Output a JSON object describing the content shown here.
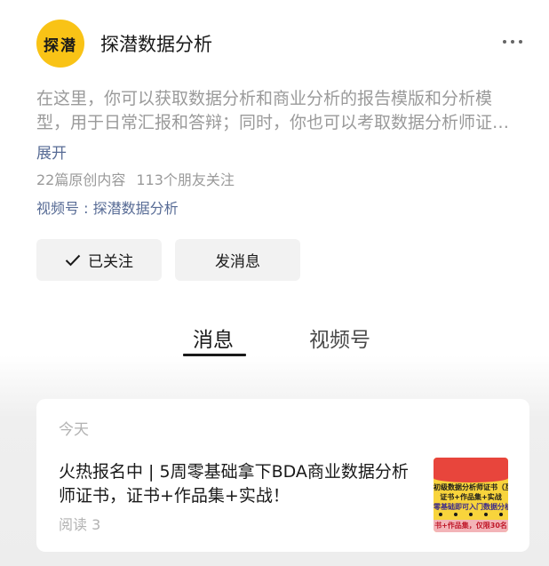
{
  "profile": {
    "avatar_text": "探潜",
    "name": "探潜数据分析",
    "description": "在这里，你可以获取数据分析和商业分析的报告模版和分析模型，用于日常汇报和答辩；同时，你也可以考取数据分析师证书，提升职场竞争力。",
    "expand_label": "展开",
    "original_count": "22篇原创内容",
    "friends_follow": "113个朋友关注",
    "channel": "视频号 : 探潜数据分析"
  },
  "actions": {
    "follow_label": "已关注",
    "message_label": "发消息"
  },
  "tabs": [
    {
      "label": "消息",
      "active": true
    },
    {
      "label": "视频号",
      "active": false
    }
  ],
  "article_card": {
    "date": "今天",
    "title": "火热报名中 | 5周零基础拿下BDA商业数据分析师证书，证书+作品集+实战！",
    "read_count": "阅读 3",
    "thumbnail": {
      "line1": "初级数据分析师证书（互",
      "line2": "证书+作品集+实战",
      "line3": "零基础即可入门数据分析",
      "line4": "书+作品集，仅限30名"
    }
  },
  "colors": {
    "avatar_bg": "#f9c316",
    "link": "#576b95",
    "muted": "#9a9a9a"
  },
  "icons": {
    "more": "more-dots-icon",
    "follow_check": "check-icon"
  }
}
